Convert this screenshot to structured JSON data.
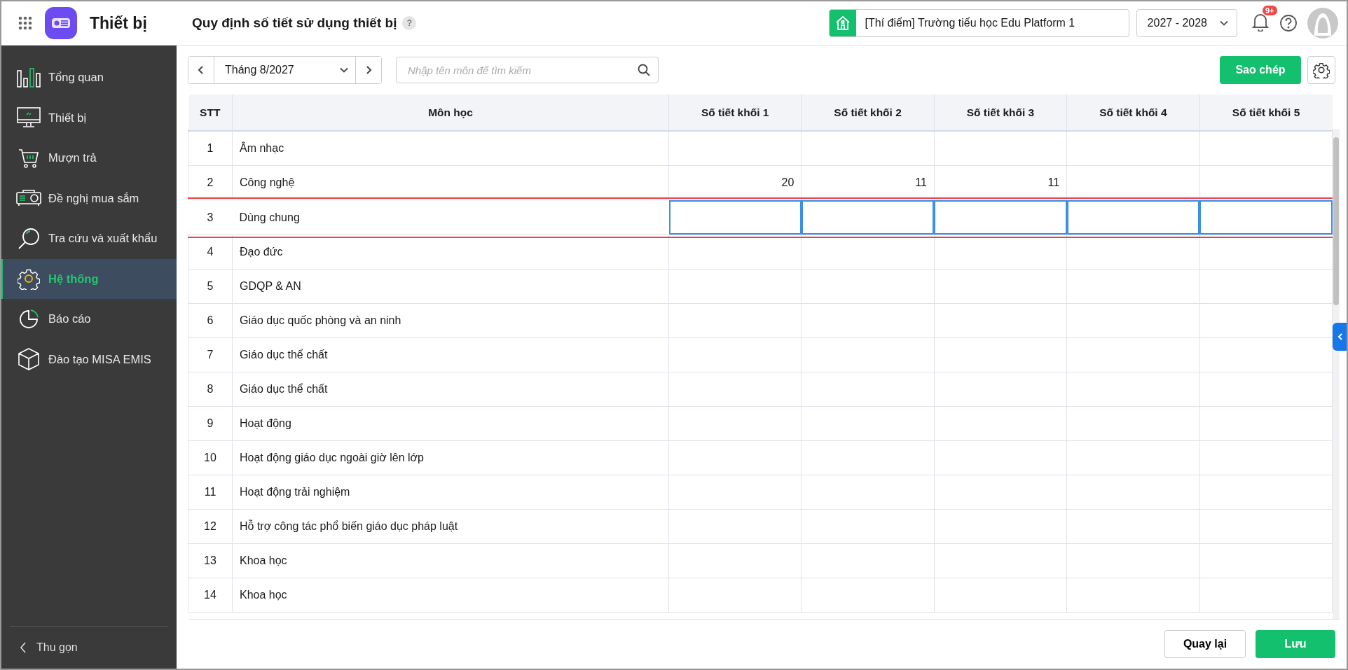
{
  "app": {
    "name": "Thiết bị"
  },
  "page": {
    "title": "Quy định số tiết sử dụng thiết bị",
    "help": "?"
  },
  "header": {
    "school": "[Thí điểm] Trường tiểu học Edu Platform 1",
    "year": "2027 - 2028",
    "notification_badge": "9+"
  },
  "sidebar": {
    "items": [
      {
        "label": "Tổng quan",
        "selected": false
      },
      {
        "label": "Thiết bị",
        "selected": false
      },
      {
        "label": "Mượn trả",
        "selected": false
      },
      {
        "label": "Đề nghị mua sắm",
        "selected": false
      },
      {
        "label": "Tra cứu và xuất khẩu",
        "selected": false
      },
      {
        "label": "Hệ thống",
        "selected": true
      },
      {
        "label": "Báo cáo",
        "selected": false
      },
      {
        "label": "Đào tạo MISA EMIS",
        "selected": false
      }
    ],
    "collapse": "Thu gọn"
  },
  "toolbar": {
    "month": "Tháng 8/2027",
    "search_placeholder": "Nhập tên môn để tìm kiếm",
    "copy_button": "Sao chép"
  },
  "table": {
    "columns": [
      "STT",
      "Môn học",
      "Số tiết khối 1",
      "Số tiết khối 2",
      "Số tiết khối 3",
      "Số tiết khối 4",
      "Số tiết khối 5"
    ],
    "rows": [
      {
        "stt": "1",
        "subject": "Âm nhạc",
        "editing": false
      },
      {
        "stt": "2",
        "subject": "Công nghệ",
        "grade_1": "20",
        "grade_2": "11",
        "grade_3": "11",
        "editing": false
      },
      {
        "stt": "3",
        "subject": "Dùng chung",
        "editing": true
      },
      {
        "stt": "4",
        "subject": "Đạo đức",
        "editing": false
      },
      {
        "stt": "5",
        "subject": "GDQP & AN",
        "editing": false
      },
      {
        "stt": "6",
        "subject": "Giáo dục quốc phòng và an ninh",
        "editing": false
      },
      {
        "stt": "7",
        "subject": "Giáo dục thể chất",
        "editing": false
      },
      {
        "stt": "8",
        "subject": "Giáo dục thể chất",
        "editing": false
      },
      {
        "stt": "9",
        "subject": "Hoạt động",
        "editing": false
      },
      {
        "stt": "10",
        "subject": "Hoạt động giáo dục ngoài giờ lên lớp",
        "editing": false
      },
      {
        "stt": "11",
        "subject": "Hoạt động trải nghiệm",
        "editing": false
      },
      {
        "stt": "12",
        "subject": "Hỗ trợ công tác phổ biến giáo dục pháp luật",
        "editing": false
      },
      {
        "stt": "13",
        "subject": "Khoa học",
        "editing": false
      },
      {
        "stt": "14",
        "subject": "Khoa học",
        "editing": false
      }
    ]
  },
  "footer": {
    "back_button": "Quay lại",
    "save_button": "Lưu"
  }
}
